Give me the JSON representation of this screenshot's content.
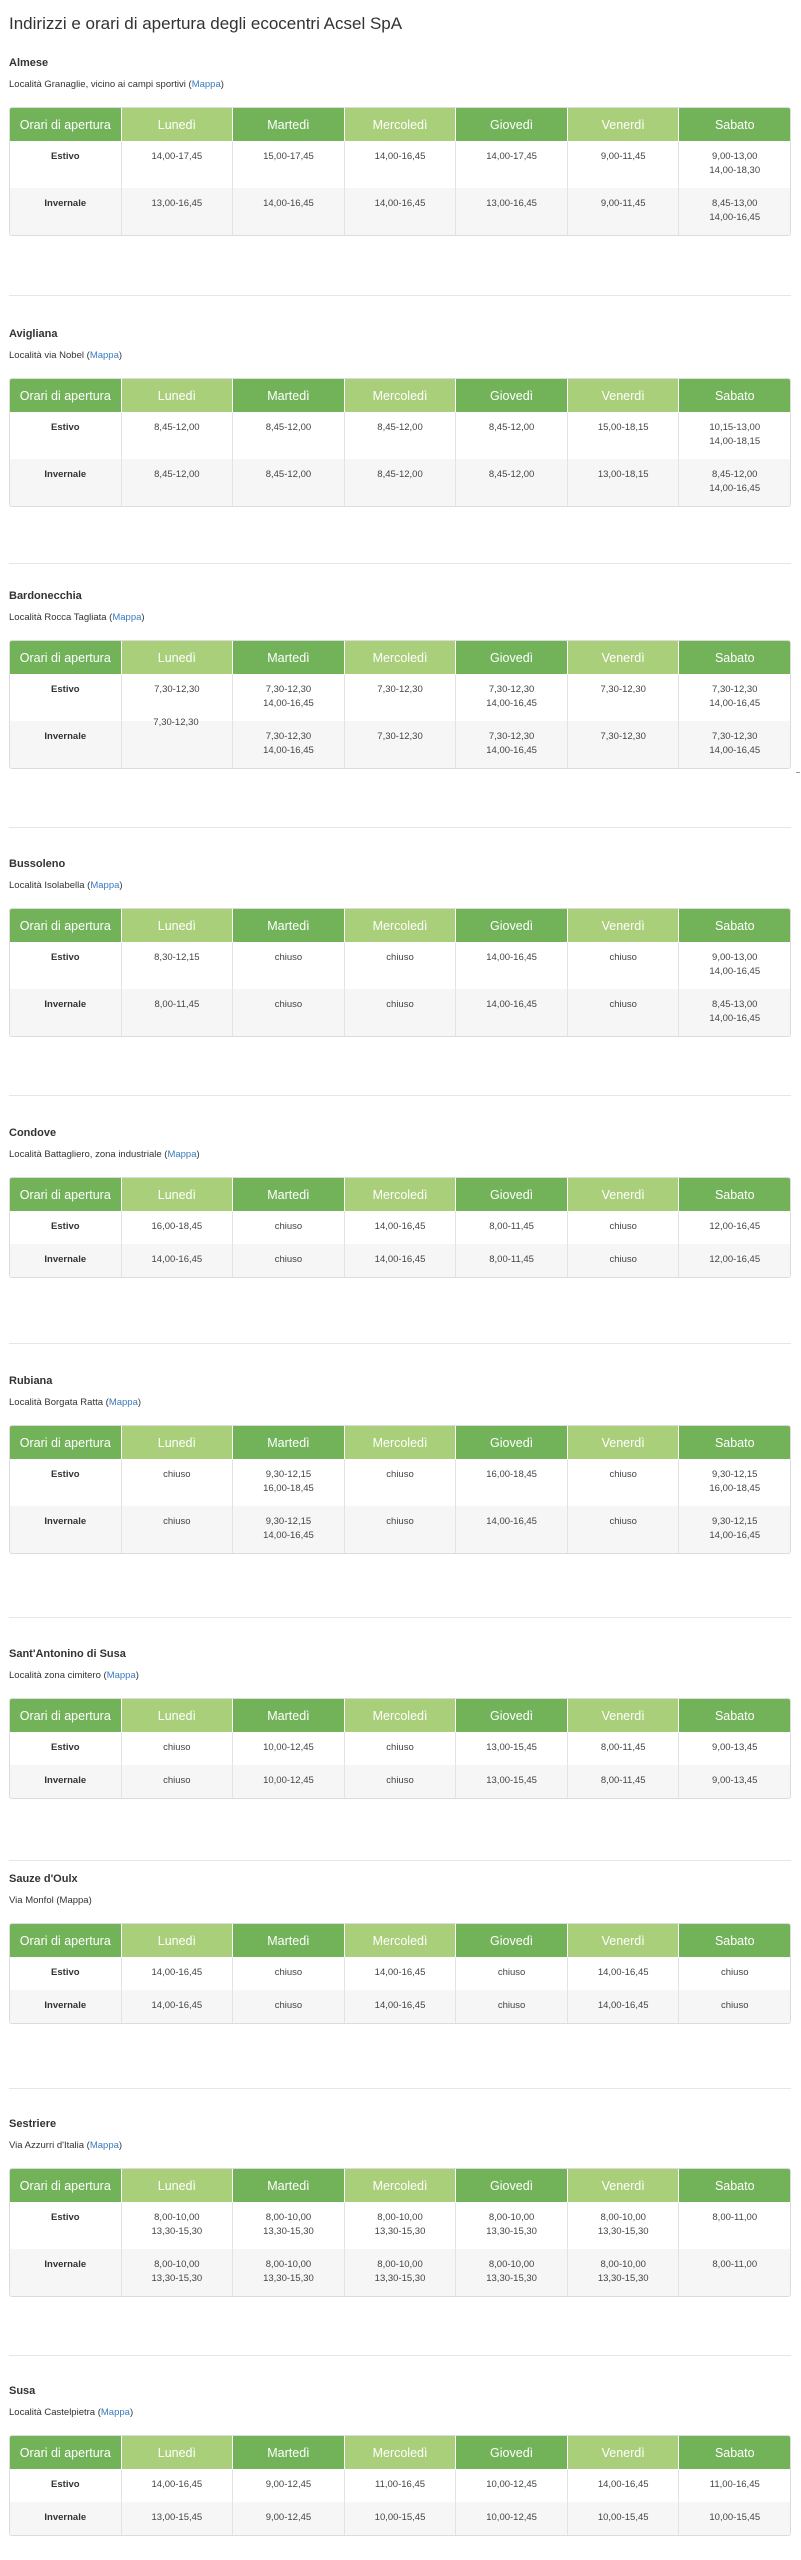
{
  "page": {
    "title": "Indirizzi e orari di apertura degli ecocentri Acsel SpA"
  },
  "table_headers": [
    "Orari di apertura",
    "Lunedì",
    "Martedì",
    "Mercoledì",
    "Giovedì",
    "Venerdì",
    "Sabato"
  ],
  "colors": {
    "header_dark": "#72b35a",
    "header_light": "#aacf7a",
    "link": "#3a7bbf"
  },
  "centers": [
    {
      "name": "Almese",
      "address": "Località Granaglie, vicino ai campi sportivi",
      "map_label": "Mappa",
      "rows": [
        {
          "season": "Estivo",
          "cells": [
            "14,00-17,45",
            "15,00-17,45",
            "14,00-16,45",
            "14,00-17,45",
            "9,00-11,45",
            "9,00-13,00\n14,00-18,30"
          ]
        },
        {
          "season": "Invernale",
          "cells": [
            "13,00-16,45",
            "14,00-16,45",
            "14,00-16,45",
            "13,00-16,45",
            "9,00-11,45",
            "8,45-13,00\n14,00-16,45"
          ]
        }
      ]
    },
    {
      "name": "Avigliana",
      "address": "Località via Nobel",
      "map_label": "Mappa",
      "rows": [
        {
          "season": "Estivo",
          "cells": [
            "8,45-12,00",
            "8,45-12,00",
            "8,45-12,00",
            "8,45-12,00",
            "15,00-18,15",
            "10,15-13,00\n14,00-18,15"
          ]
        },
        {
          "season": "Invernale",
          "cells": [
            "8,45-12,00",
            "8,45-12,00",
            "8,45-12,00",
            "8,45-12,00",
            "13,00-18,15",
            "8,45-12,00\n14,00-16,45"
          ]
        }
      ]
    },
    {
      "name": "Bardonecchia",
      "address": "Località Rocca Tagliata",
      "map_label": "Mappa",
      "floating_value": "7,30-12,30",
      "rows": [
        {
          "season": "Estivo",
          "cells": [
            "7,30-12,30",
            "7,30-12,30\n14,00-16,45",
            "7,30-12,30",
            "7,30-12,30\n14,00-16,45",
            "7,30-12,30",
            "7,30-12,30\n14,00-16,45"
          ]
        },
        {
          "season": "Invernale",
          "cells": [
            "",
            "7,30-12,30\n14,00-16,45",
            "7,30-12,30",
            "7,30-12,30\n14,00-16,45",
            "7,30-12,30",
            "7,30-12,30\n14,00-16,45"
          ]
        }
      ]
    },
    {
      "name": "Bussoleno",
      "address": "Località Isolabella",
      "map_label": "Mappa",
      "rows": [
        {
          "season": "Estivo",
          "cells": [
            "8,30-12,15",
            "chiuso",
            "chiuso",
            "14,00-16,45",
            "chiuso",
            "9,00-13,00\n14,00-16,45"
          ]
        },
        {
          "season": "Invernale",
          "cells": [
            "8,00-11,45",
            "chiuso",
            "chiuso",
            "14,00-16,45",
            "chiuso",
            "8,45-13,00\n14,00-16,45"
          ]
        }
      ]
    },
    {
      "name": "Condove",
      "address": "Località Battagliero, zona industriale",
      "map_label": "Mappa",
      "rows": [
        {
          "season": "Estivo",
          "cells": [
            "16,00-18,45",
            "chiuso",
            "14,00-16,45",
            "8,00-11,45",
            "chiuso",
            "12,00-16,45"
          ]
        },
        {
          "season": "Invernale",
          "cells": [
            "14,00-16,45",
            "chiuso",
            "14,00-16,45",
            "8,00-11,45",
            "chiuso",
            "12,00-16,45"
          ]
        }
      ]
    },
    {
      "name": "Rubiana",
      "address": "Località Borgata Ratta",
      "map_label": "Mappa",
      "rows": [
        {
          "season": "Estivo",
          "cells": [
            "chiuso",
            "9,30-12,15\n16,00-18,45",
            "chiuso",
            "16,00-18,45",
            "chiuso",
            "9,30-12,15\n16,00-18,45"
          ]
        },
        {
          "season": "Invernale",
          "cells": [
            "chiuso",
            "9,30-12,15\n14,00-16,45",
            "chiuso",
            "14,00-16,45",
            "chiuso",
            "9,30-12,15\n14,00-16,45"
          ]
        }
      ]
    },
    {
      "name": "Sant'Antonino di Susa",
      "address": "Località zona cimitero",
      "map_label": "Mappa",
      "rows": [
        {
          "season": "Estivo",
          "cells": [
            "chiuso",
            "10,00-12,45",
            "chiuso",
            "13,00-15,45",
            "8,00-11,45",
            "9,00-13,45"
          ]
        },
        {
          "season": "Invernale",
          "cells": [
            "chiuso",
            "10,00-12,45",
            "chiuso",
            "13,00-15,45",
            "8,00-11,45",
            "9,00-13,45"
          ]
        }
      ]
    },
    {
      "name": "Sauze d'Oulx",
      "address": "Via  Monfol",
      "map_label": "Mappa",
      "rows": [
        {
          "season": "Estivo",
          "cells": [
            "14,00-16,45",
            "chiuso",
            "14,00-16,45",
            "chiuso",
            "14,00-16,45",
            "chiuso"
          ]
        },
        {
          "season": "Invernale",
          "cells": [
            "14,00-16,45",
            "chiuso",
            "14,00-16,45",
            "chiuso",
            "14,00-16,45",
            "chiuso"
          ]
        }
      ]
    },
    {
      "name": "Sestriere",
      "address": "Via Azzurri d'Italia",
      "map_label": "Mappa",
      "rows": [
        {
          "season": "Estivo",
          "cells": [
            "8,00-10,00\n13,30-15,30",
            "8,00-10,00\n13,30-15,30",
            "8,00-10,00\n13,30-15,30",
            "8,00-10,00\n13,30-15,30",
            "8,00-10,00\n13,30-15,30",
            "8,00-11,00"
          ]
        },
        {
          "season": "Invernale",
          "cells": [
            "8,00-10,00\n13,30-15,30",
            "8,00-10,00\n13,30-15,30",
            "8,00-10,00\n13,30-15,30",
            "8,00-10,00\n13,30-15,30",
            "8,00-10,00\n13,30-15,30",
            "8,00-11,00"
          ]
        }
      ]
    },
    {
      "name": "Susa",
      "address": "Località Castelpietra",
      "map_label": "Mappa",
      "rows": [
        {
          "season": "Estivo",
          "cells": [
            "14,00-16,45",
            "9,00-12,45",
            "11,00-16,45",
            "10,00-12,45",
            "14,00-16,45",
            "11,00-16,45"
          ]
        },
        {
          "season": "Invernale",
          "cells": [
            "13,00-15,45",
            "9,00-12,45",
            "10,00-15,45",
            "10,00-12,45",
            "10,00-15,45",
            "10,00-15,45"
          ]
        }
      ]
    }
  ]
}
